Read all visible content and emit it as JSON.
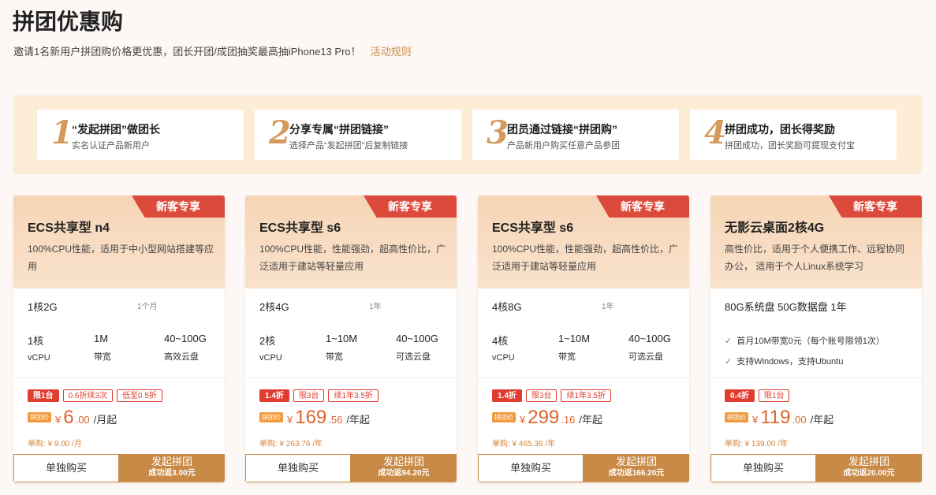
{
  "header": {
    "title": "拼团优惠购",
    "subtitle": "邀请1名新用户拼团购价格更优惠，团长开团/成团抽奖最高抽iPhone13 Pro！",
    "rules_link": "活动规则"
  },
  "steps": [
    {
      "num": "1",
      "title": "“发起拼团”做团长",
      "desc": "实名认证产品新用户"
    },
    {
      "num": "2",
      "title": "分享专属“拼团链接”",
      "desc": "选择产品“发起拼团”后复制链接"
    },
    {
      "num": "3",
      "title": "团员通过链接“拼团购”",
      "desc": "产品新用户购买任意产品参团"
    },
    {
      "num": "4",
      "title": "拼团成功，团长得奖励",
      "desc": "拼团成功，团长奖励可提现支付宝"
    }
  ],
  "cards": [
    {
      "tag": "新客专享",
      "name": "ECS共享型 n4",
      "desc": "100%CPU性能，适用于中小型网站搭建等应用",
      "spec": "1核2G",
      "duration": "1个月",
      "specs": [
        {
          "value": "1核",
          "label": "vCPU"
        },
        {
          "value": "1M",
          "label": "带宽"
        },
        {
          "value": "40~100G",
          "label": "高效云盘"
        }
      ],
      "chips": [
        "限1台",
        "0.6折续3次",
        "低至0.5折"
      ],
      "price_tag": "拼团价",
      "currency": "¥",
      "price_int": "6",
      "price_dec": ".00",
      "unit": "/月起",
      "original": "单购: ¥ 9.00 /月",
      "buy_label": "单独购买",
      "group_label": "发起拼团",
      "group_sub": "成功返3.00元"
    },
    {
      "tag": "新客专享",
      "name": "ECS共享型 s6",
      "desc": "100%CPU性能，性能强劲，超高性价比，广泛适用于建站等轻量应用",
      "spec": "2核4G",
      "duration": "1年",
      "specs": [
        {
          "value": "2核",
          "label": "vCPU"
        },
        {
          "value": "1~10M",
          "label": "带宽"
        },
        {
          "value": "40~100G",
          "label": "可选云盘"
        }
      ],
      "chips": [
        "1.4折",
        "限3台",
        "续1年3.5折"
      ],
      "price_tag": "拼团价",
      "currency": "¥",
      "price_int": "169",
      "price_dec": ".56",
      "unit": "/年起",
      "original": "单购: ¥ 263.76 /年",
      "buy_label": "单独购买",
      "group_label": "发起拼团",
      "group_sub": "成功返94.20元"
    },
    {
      "tag": "新客专享",
      "name": "ECS共享型 s6",
      "desc": "100%CPU性能，性能强劲，超高性价比，广泛适用于建站等轻量应用",
      "spec": "4核8G",
      "duration": "1年",
      "specs": [
        {
          "value": "4核",
          "label": "vCPU"
        },
        {
          "value": "1~10M",
          "label": "带宽"
        },
        {
          "value": "40~100G",
          "label": "可选云盘"
        }
      ],
      "chips": [
        "1.4折",
        "限3台",
        "续1年3.5折"
      ],
      "price_tag": "拼团价",
      "currency": "¥",
      "price_int": "299",
      "price_dec": ".16",
      "unit": "/年起",
      "original": "单购: ¥ 465.36 /年",
      "buy_label": "单独购买",
      "group_label": "发起拼团",
      "group_sub": "成功返166.20元"
    },
    {
      "tag": "新客专享",
      "name": "无影云桌面2核4G",
      "desc": "高性价比，适用于个人便携工作、远程协同办公， 适用于个人Linux系统学习",
      "spec": "80G系统盘 50G数据盘 1年",
      "features": [
        "首月10M带宽0元（每个账号限领1次）",
        "支持Windows，支持Ubuntu"
      ],
      "chips": [
        "0.4折",
        "限1台"
      ],
      "price_tag": "拼团价",
      "currency": "¥",
      "price_int": "119",
      "price_dec": ".00",
      "unit": "/年起",
      "original": "单购: ¥ 139.00 /年",
      "buy_label": "单独购买",
      "group_label": "发起拼团",
      "group_sub": "成功返20.00元"
    }
  ]
}
